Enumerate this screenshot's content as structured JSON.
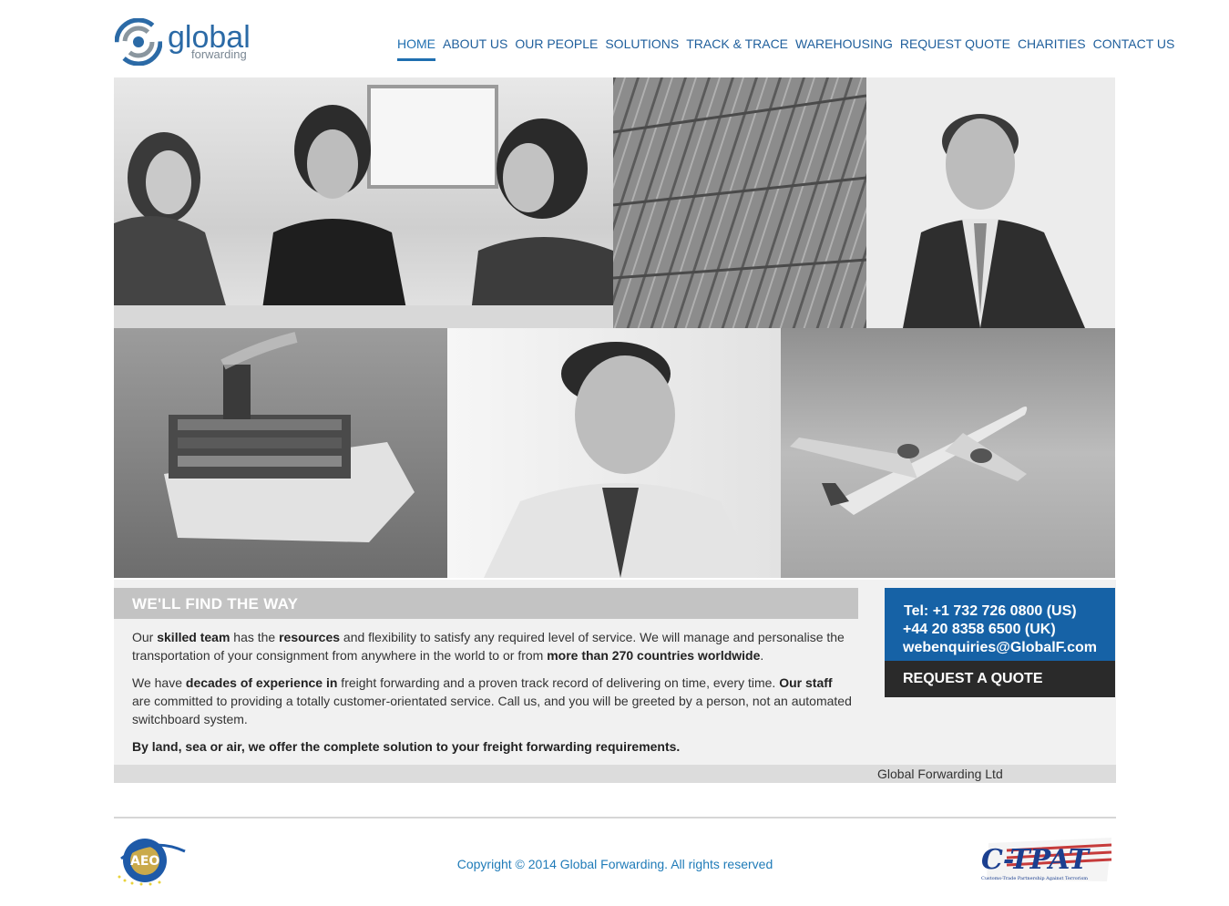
{
  "header": {
    "logo_word": "global",
    "logo_sub": "forwarding",
    "nav": [
      {
        "label": "HOME",
        "active": true
      },
      {
        "label": "ABOUT US"
      },
      {
        "label": "OUR PEOPLE"
      },
      {
        "label": "SOLUTIONS"
      },
      {
        "label": "TRACK & TRACE"
      },
      {
        "label": "WAREHOUSING"
      },
      {
        "label": "REQUEST QUOTE"
      },
      {
        "label": "CHARITIES"
      },
      {
        "label": "CONTACT US"
      }
    ]
  },
  "hero": {
    "photos": [
      "three-women-photo",
      "shipping-containers-photo",
      "businessman-photo",
      "container-ship-photo",
      "smiling-man-photo",
      "airplane-photo"
    ]
  },
  "main": {
    "heading": "WE'LL FIND THE WAY",
    "p1": [
      "Our ",
      "skilled team",
      " has the ",
      "resources",
      " and flexibility to satisfy any required level of service. We will manage and personalise the transportation of your consignment from anywhere in the world to or from ",
      "more than 270 countries worldwide",
      "."
    ],
    "p2": [
      "We have ",
      "decades of experience in",
      " freight forwarding and a proven track record of delivering on time, every time. ",
      "Our staff",
      " are committed to providing a totally customer-orientated service. Call us, and you will be greeted by a person, not an automated switchboard system."
    ],
    "p3": "By land, sea or air, we offer the complete solution to your freight forwarding requirements.",
    "company": "Global Forwarding Ltd"
  },
  "contact": {
    "tel_us": "Tel: +1 732 726 0800 (US)",
    "tel_uk": "+44 20 8358 6500 (UK)",
    "email": "webenquiries@GlobalF.com",
    "quote_button": "REQUEST A QUOTE"
  },
  "footer": {
    "copyright": "Copyright © 2014 Global Forwarding. All rights reserved",
    "aeo_text": "AEO",
    "ctpat_text": "C-TPAT",
    "ctpat_sub": "Customs-Trade Partnership Against Terrorism"
  },
  "colors": {
    "brand": "#1662a6",
    "nav": "#1f5f9c",
    "dark": "#2a2a2a"
  }
}
